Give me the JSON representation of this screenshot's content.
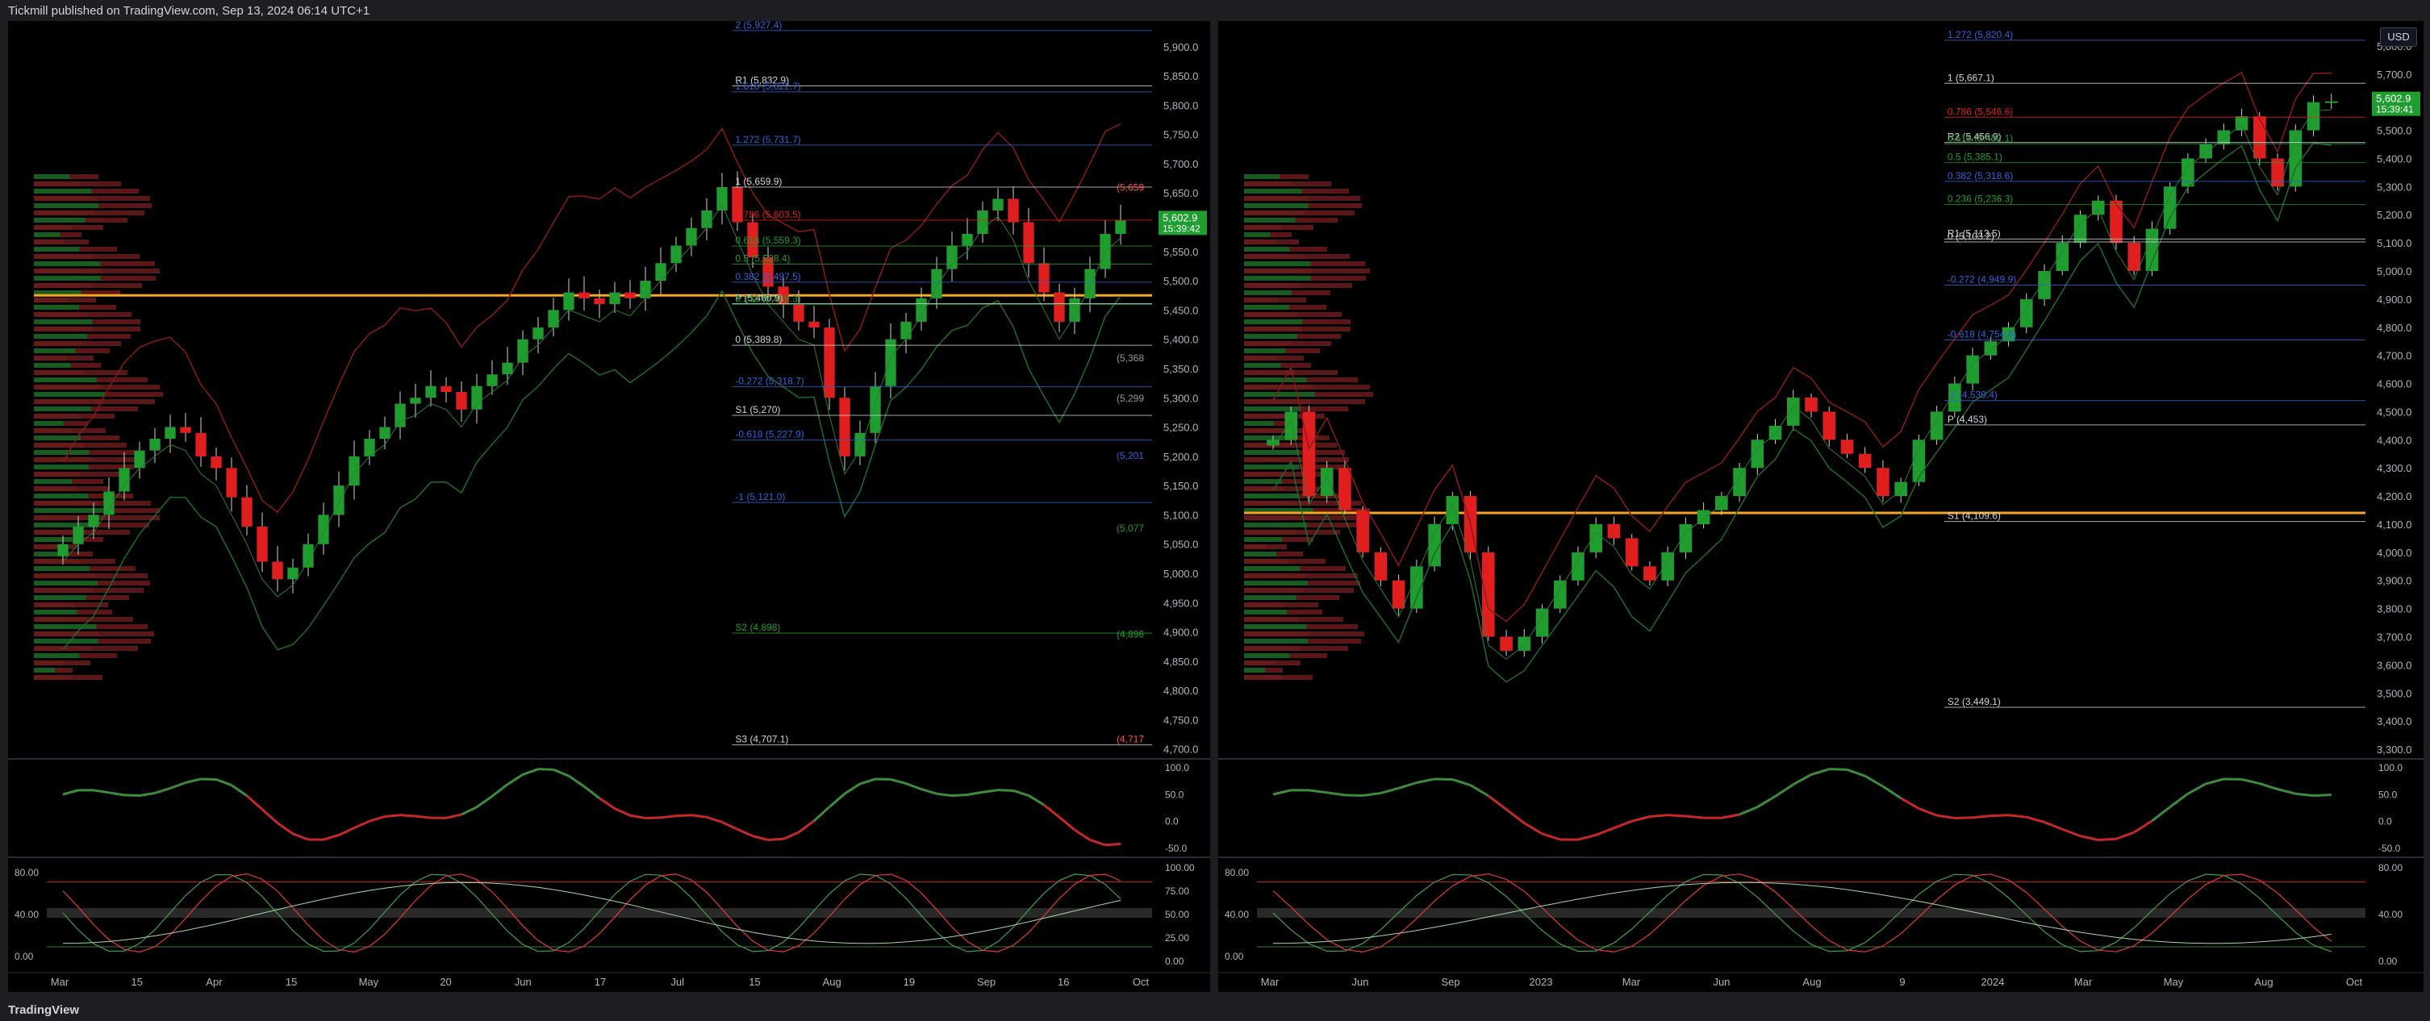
{
  "header": {
    "publisher": "Tickmill published on TradingView.com, Sep 13, 2024 06:14 UTC+1"
  },
  "footer": {
    "logo": "TradingView"
  },
  "colors": {
    "bg": "#000000",
    "up": "#1f9e2f",
    "down": "#e01e1e",
    "orange": "#f5a623",
    "blue": "#2e64d8",
    "green_dot": "#4caf50",
    "red_dot": "#ff4d4d"
  },
  "chart_data": [
    {
      "type": "candlestick",
      "name": "left-daily",
      "x_ticks": [
        "Mar",
        "15",
        "Apr",
        "15",
        "May",
        "20",
        "Jun",
        "17",
        "Jul",
        "15",
        "Aug",
        "19",
        "Sep",
        "16",
        "Oct"
      ],
      "y_ticks": [
        "5,900.0",
        "5,850.0",
        "5,800.0",
        "5,750.0",
        "5,700.0",
        "5,650.0",
        "5,600.0",
        "5,550.0",
        "5,500.0",
        "5,450.0",
        "5,400.0",
        "5,350.0",
        "5,300.0",
        "5,250.0",
        "5,200.0",
        "5,150.0",
        "5,100.0",
        "5,050.0",
        "5,000.0",
        "4,950.0",
        "4,900.0",
        "4,850.0",
        "4,800.0",
        "4,750.0",
        "4,700.0"
      ],
      "ylim": [
        4690,
        5930
      ],
      "last_price": "5,602.9",
      "countdown": "15:39:42",
      "close_series": [
        5050,
        5080,
        5100,
        5140,
        5180,
        5210,
        5230,
        5250,
        5240,
        5200,
        5180,
        5130,
        5080,
        5020,
        4990,
        5010,
        5050,
        5100,
        5150,
        5200,
        5230,
        5250,
        5290,
        5300,
        5320,
        5310,
        5280,
        5320,
        5340,
        5360,
        5400,
        5420,
        5450,
        5480,
        5470,
        5460,
        5480,
        5470,
        5500,
        5530,
        5560,
        5590,
        5620,
        5660,
        5600,
        5540,
        5490,
        5460,
        5430,
        5420,
        5300,
        5200,
        5240,
        5320,
        5400,
        5430,
        5470,
        5520,
        5560,
        5580,
        5620,
        5640,
        5600,
        5530,
        5480,
        5430,
        5470,
        5520,
        5580,
        5602.9
      ],
      "annotations": [
        {
          "label": "2 (5,927.4)",
          "value": 5927.4,
          "color": "#2e64d8"
        },
        {
          "label": "R1 (5,832.9)",
          "value": 5832.9,
          "color": "#d1d4dc"
        },
        {
          "label": "1.618 (5,822.7)",
          "value": 5822.7,
          "color": "#2e64d8"
        },
        {
          "label": "1.272 (5,731.7)",
          "value": 5731.7,
          "color": "#2e64d8"
        },
        {
          "label": "1 (5,659.9)",
          "value": 5659.9,
          "color": "#d1d4dc"
        },
        {
          "label": "0.786 (5,603.5)",
          "value": 5603.5,
          "color": "#e01e1e"
        },
        {
          "label": "0.618 (5,559.3)",
          "value": 5559.3,
          "color": "#1f9e2f"
        },
        {
          "label": "0.5 (5,528.4)",
          "value": 5528.4,
          "color": "#1f9e2f"
        },
        {
          "label": "0.382 (5,497.5)",
          "value": 5497.5,
          "color": "#2e64d8"
        },
        {
          "label": "P (5,460.9)",
          "value": 5460.9,
          "color": "#d1d4dc"
        },
        {
          "label": "0.236 (5,459.3)",
          "value": 5459.3,
          "color": "#1f9e2f"
        },
        {
          "label": "0 (5,389.8)",
          "value": 5389.8,
          "color": "#d1d4dc"
        },
        {
          "label": "-0.272 (5,318.7)",
          "value": 5318.7,
          "color": "#2e64d8"
        },
        {
          "label": "S1 (5,270)",
          "value": 5270,
          "color": "#d1d4dc"
        },
        {
          "label": "-0.618 (5,227.9)",
          "value": 5227.9,
          "color": "#2e64d8"
        },
        {
          "label": "-1 (5,121.0)",
          "value": 5121.0,
          "color": "#2e64d8"
        },
        {
          "label": "S2 (4,898)",
          "value": 4898,
          "color": "#1f9e2f"
        },
        {
          "label": "S3 (4,707.1)",
          "value": 4707.1,
          "color": "#d1d4dc"
        }
      ],
      "right_tags": [
        {
          "label": "(5,659",
          "value": 5659,
          "color": "#ff4d4d"
        },
        {
          "label": "(5,368",
          "value": 5368,
          "color": "#9598a1"
        },
        {
          "label": "(5,299",
          "value": 5299,
          "color": "#9598a1"
        },
        {
          "label": "(5,201",
          "value": 5201,
          "color": "#2e64d8"
        },
        {
          "label": "(5,077",
          "value": 5077,
          "color": "#1f9e2f"
        },
        {
          "label": "(4,896",
          "value": 4896,
          "color": "#1f9e2f"
        },
        {
          "label": "(4,717",
          "value": 4717,
          "color": "#ff4d4d"
        }
      ],
      "orange_level": 5475,
      "osc1_ticks": [
        "100.0",
        "50.0",
        "0.0",
        "-50.0"
      ],
      "osc2_ticks": [
        "100.00",
        "75.00",
        "50.00",
        "25.00",
        "0.00"
      ],
      "osc2_left_ticks": [
        "80.00",
        "40.00",
        "0.00"
      ]
    },
    {
      "type": "candlestick",
      "name": "right-weekly",
      "x_ticks": [
        "Mar",
        "Jun",
        "Sep",
        "2023",
        "Mar",
        "Jun",
        "Aug",
        "9",
        "2024",
        "Mar",
        "May",
        "Aug",
        "Oct"
      ],
      "y_ticks": [
        "5,800.0",
        "5,700.0",
        "5,600.0",
        "5,500.0",
        "5,400.0",
        "5,300.0",
        "5,200.0",
        "5,100.0",
        "5,000.0",
        "4,900.0",
        "4,800.0",
        "4,700.0",
        "4,600.0",
        "4,500.0",
        "4,400.0",
        "4,300.0",
        "4,200.0",
        "4,100.0",
        "4,000.0",
        "3,900.0",
        "3,800.0",
        "3,700.0",
        "3,600.0",
        "3,500.0",
        "3,400.0",
        "3,300.0"
      ],
      "ylim": [
        3280,
        5860
      ],
      "last_price": "5,602.9",
      "countdown": "15:39:41",
      "currency_button": "USD",
      "close_series": [
        4400,
        4500,
        4200,
        4300,
        4150,
        4000,
        3900,
        3800,
        3950,
        4100,
        4200,
        4000,
        3700,
        3650,
        3700,
        3800,
        3900,
        4000,
        4100,
        4050,
        3950,
        3900,
        4000,
        4100,
        4150,
        4200,
        4300,
        4400,
        4450,
        4550,
        4500,
        4400,
        4350,
        4300,
        4200,
        4250,
        4400,
        4500,
        4600,
        4700,
        4750,
        4800,
        4900,
        5000,
        5100,
        5200,
        5250,
        5100,
        5000,
        5150,
        5300,
        5400,
        5450,
        5500,
        5550,
        5400,
        5300,
        5500,
        5600,
        5602.9
      ],
      "annotations": [
        {
          "label": "1.272 (5,820.4)",
          "value": 5820.4,
          "color": "#2e64d8"
        },
        {
          "label": "1 (5,667.1)",
          "value": 5667.1,
          "color": "#d1d4dc"
        },
        {
          "label": "0.786 (5,546.6)",
          "value": 5546.6,
          "color": "#e01e1e"
        },
        {
          "label": "R2 (5,456.9)",
          "value": 5456.9,
          "color": "#d1d4dc"
        },
        {
          "label": "0.618 (5,452.1)",
          "value": 5452.1,
          "color": "#1f9e2f"
        },
        {
          "label": "0.5 (5,385.1)",
          "value": 5385.1,
          "color": "#1f9e2f"
        },
        {
          "label": "0.382 (5,318.6)",
          "value": 5318.6,
          "color": "#2e64d8"
        },
        {
          "label": "0.236 (5,236.3)",
          "value": 5236.3,
          "color": "#1f9e2f"
        },
        {
          "label": "R1 (5,113.5)",
          "value": 5113.5,
          "color": "#d1d4dc"
        },
        {
          "label": "0 (5,103.2)",
          "value": 5103.2,
          "color": "#d1d4dc"
        },
        {
          "label": "-0.272 (4,949.9)",
          "value": 4949.9,
          "color": "#2e64d8"
        },
        {
          "label": "-0.618 (4,754.8)",
          "value": 4754.8,
          "color": "#2e64d8"
        },
        {
          "label": "-1 (4,539.4)",
          "value": 4539.4,
          "color": "#2e64d8"
        },
        {
          "label": "P (4,453)",
          "value": 4453,
          "color": "#d1d4dc"
        },
        {
          "label": "S1 (4,109.6)",
          "value": 4109.6,
          "color": "#d1d4dc"
        },
        {
          "label": "S2 (3,449.1)",
          "value": 3449.1,
          "color": "#d1d4dc"
        }
      ],
      "orange_level": 4140,
      "osc1_ticks": [
        "100.0",
        "50.0",
        "0.0",
        "-50.0"
      ],
      "osc2_ticks": [
        "80.00",
        "40.00",
        "0.00"
      ],
      "osc2_left_ticks": [
        "80.00",
        "40.00",
        "0.00"
      ]
    }
  ]
}
